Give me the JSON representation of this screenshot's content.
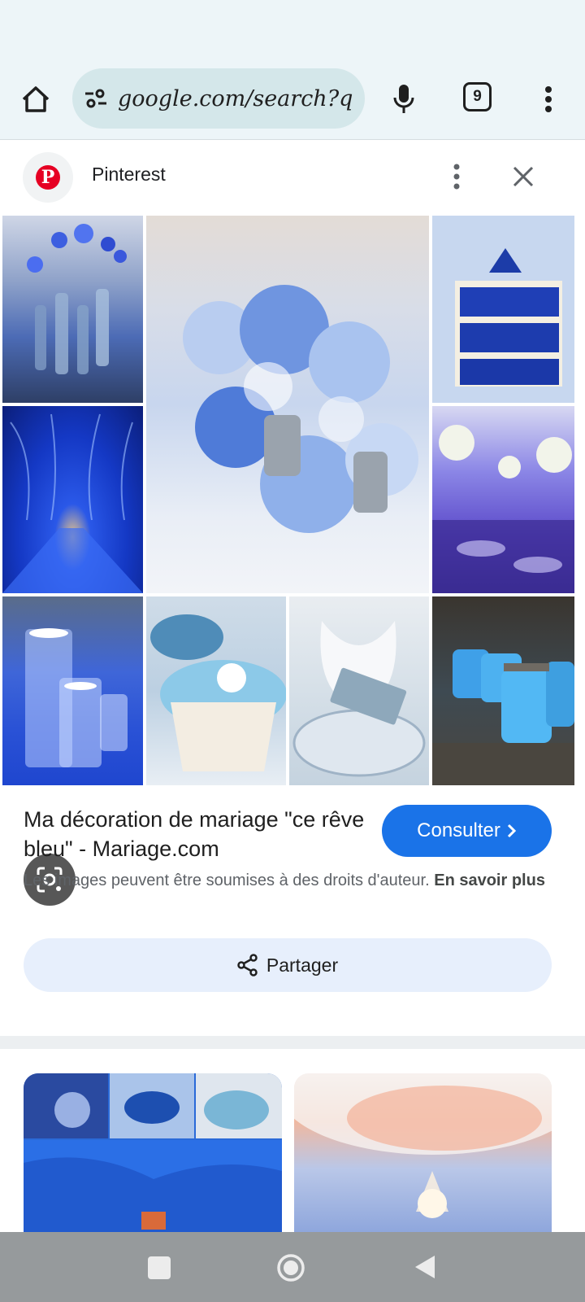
{
  "browser": {
    "url": "google.com/search?q=",
    "tab_count": "9",
    "icons": [
      "home-icon",
      "tune-icon",
      "mic-icon",
      "tabs-icon",
      "more-vert-icon"
    ]
  },
  "result": {
    "source_name": "Pinterest",
    "source_logo_letter": "P",
    "title": "Ma décoration de mariage \"ce rêve bleu\" - Mariage.com",
    "visit_label": "Consulter",
    "copyright_text": "Les images peuvent être soumises à des droits d'auteur.",
    "learn_more_label": "En savoir plus",
    "share_label": "Partager"
  },
  "colors": {
    "accent": "#1a73e8",
    "toolbar_bg": "#edf5f8",
    "url_bar_bg": "#d4e7ea",
    "share_bg": "#e7effc",
    "pinterest_red": "#e60023"
  }
}
